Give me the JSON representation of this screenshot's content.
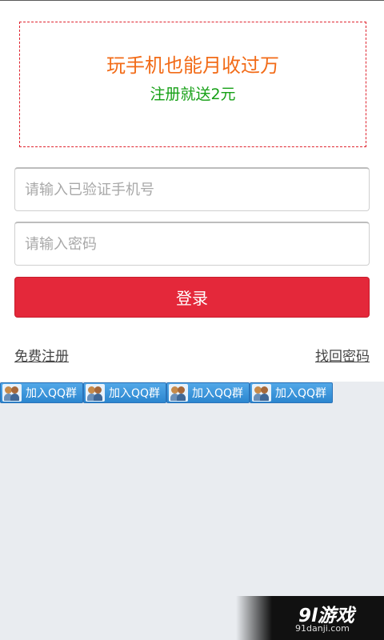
{
  "promo": {
    "title": "玩手机也能月收过万",
    "subtitle": "注册就送2元"
  },
  "form": {
    "phone_placeholder": "请输入已验证手机号",
    "password_placeholder": "请输入密码",
    "login_label": "登录"
  },
  "links": {
    "register": "免费注册",
    "forgot_password": "找回密码"
  },
  "qq_group": {
    "buttons": [
      {
        "label": "加入QQ群"
      },
      {
        "label": "加入QQ群"
      },
      {
        "label": "加入QQ群"
      },
      {
        "label": "加入QQ群"
      }
    ]
  },
  "watermark": {
    "logo": "9l游戏",
    "url": "91danji.com"
  },
  "colors": {
    "accent_red": "#e4283a",
    "promo_orange": "#f26b17",
    "promo_green": "#16a016",
    "qq_blue": "#2b86cf"
  }
}
